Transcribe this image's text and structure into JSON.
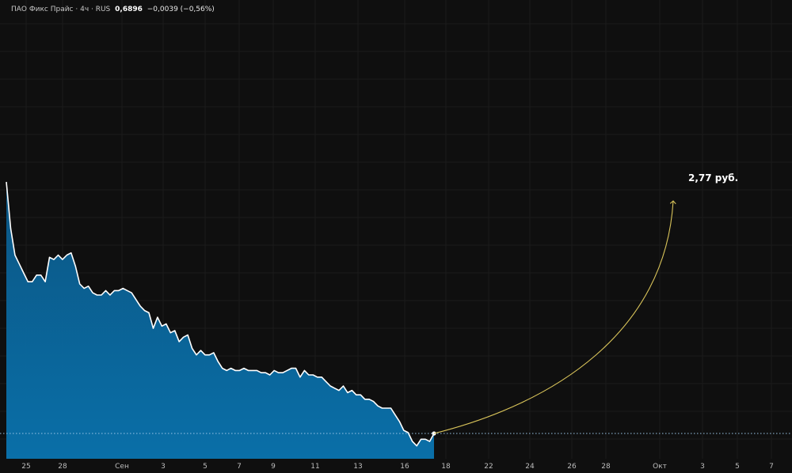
{
  "header": {
    "title": "ПАО Фикс Прайс · 4ч · RUS",
    "price": "0,6896",
    "change": "−0,0039 (−0,56%)"
  },
  "forecast": {
    "label": "2,77 руб.",
    "color": "#d9c45a"
  },
  "colors": {
    "background": "#0f0f0f",
    "grid": "#1d1d1d",
    "area_top": "#0b5a8a",
    "area_bottom": "#0a6fa8",
    "line": "#ffffff",
    "baseline": "#9ac4e6"
  },
  "chart_data": {
    "type": "area",
    "xlabels": [
      "25",
      "28",
      "Сен",
      "3",
      "5",
      "7",
      "9",
      "11",
      "13",
      "16",
      "18",
      "22",
      "24",
      "26",
      "28",
      "Окт",
      "3",
      "5",
      "7"
    ],
    "series": [
      {
        "values": [
          0.803,
          0.782,
          0.77,
          0.766,
          0.762,
          0.758,
          0.758,
          0.761,
          0.761,
          0.758,
          0.769,
          0.768,
          0.77,
          0.768,
          0.77,
          0.771,
          0.765,
          0.757,
          0.755,
          0.756,
          0.753,
          0.752,
          0.752,
          0.754,
          0.752,
          0.754,
          0.754,
          0.755,
          0.754,
          0.753,
          0.75,
          0.747,
          0.745,
          0.744,
          0.737,
          0.742,
          0.738,
          0.739,
          0.735,
          0.736,
          0.731,
          0.733,
          0.734,
          0.728,
          0.725,
          0.727,
          0.725,
          0.725,
          0.726,
          0.722,
          0.719,
          0.718,
          0.719,
          0.718,
          0.718,
          0.719,
          0.718,
          0.718,
          0.718,
          0.717,
          0.717,
          0.716,
          0.718,
          0.717,
          0.717,
          0.718,
          0.719,
          0.719,
          0.715,
          0.718,
          0.716,
          0.716,
          0.715,
          0.715,
          0.713,
          0.711,
          0.71,
          0.709,
          0.711,
          0.708,
          0.709,
          0.707,
          0.707,
          0.705,
          0.705,
          0.704,
          0.702,
          0.701,
          0.701,
          0.701,
          0.698,
          0.695,
          0.691,
          0.69,
          0.686,
          0.684,
          0.687,
          0.687,
          0.686,
          0.6896
        ]
      }
    ],
    "last_value": 0.6896,
    "forecast_target": 2.77,
    "grid": true
  }
}
